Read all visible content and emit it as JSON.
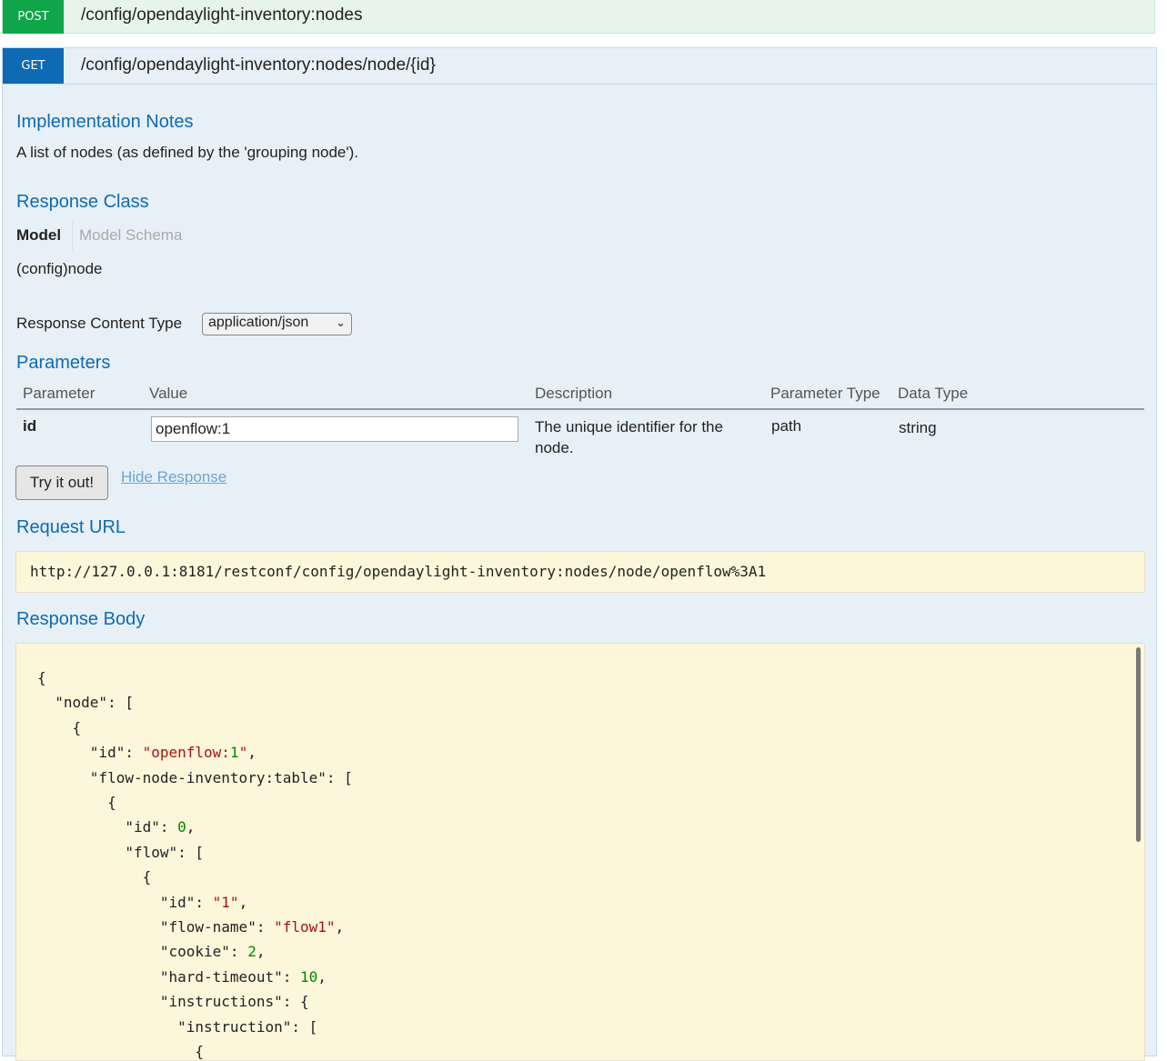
{
  "post": {
    "method": "POST",
    "path": "/config/opendaylight-inventory:nodes"
  },
  "get": {
    "method": "GET",
    "path": "/config/opendaylight-inventory:nodes/node/{id}"
  },
  "implementation_notes": {
    "heading": "Implementation Notes",
    "text": "A list of nodes (as defined by the 'grouping node')."
  },
  "response_class": {
    "heading": "Response Class",
    "tabs": [
      "Model",
      "Model Schema"
    ],
    "model_name": "(config)node"
  },
  "response_content_type": {
    "label": "Response Content Type",
    "selected": "application/json"
  },
  "parameters": {
    "heading": "Parameters",
    "columns": [
      "Parameter",
      "Value",
      "Description",
      "Parameter Type",
      "Data Type"
    ],
    "rows": [
      {
        "parameter": "id",
        "value": "openflow:1",
        "description": "The unique identifier for the node.",
        "parameter_type": "path",
        "data_type": "string"
      }
    ]
  },
  "actions": {
    "try_label": "Try it out!",
    "hide_label": "Hide Response"
  },
  "request_url": {
    "heading": "Request URL",
    "value": "http://127.0.0.1:8181/restconf/config/opendaylight-inventory:nodes/node/openflow%3A1"
  },
  "response_body": {
    "heading": "Response Body",
    "lines": [
      "{",
      "  \"node\": [",
      "    {",
      "      \"id\": \"openflow:1\",",
      "      \"flow-node-inventory:table\": [",
      "        {",
      "          \"id\": 0,",
      "          \"flow\": [",
      "            {",
      "              \"id\": \"1\",",
      "              \"flow-name\": \"flow1\",",
      "              \"cookie\": 2,",
      "              \"hard-timeout\": 10,",
      "              \"instructions\": {",
      "                \"instruction\": [",
      "                  {"
    ]
  }
}
